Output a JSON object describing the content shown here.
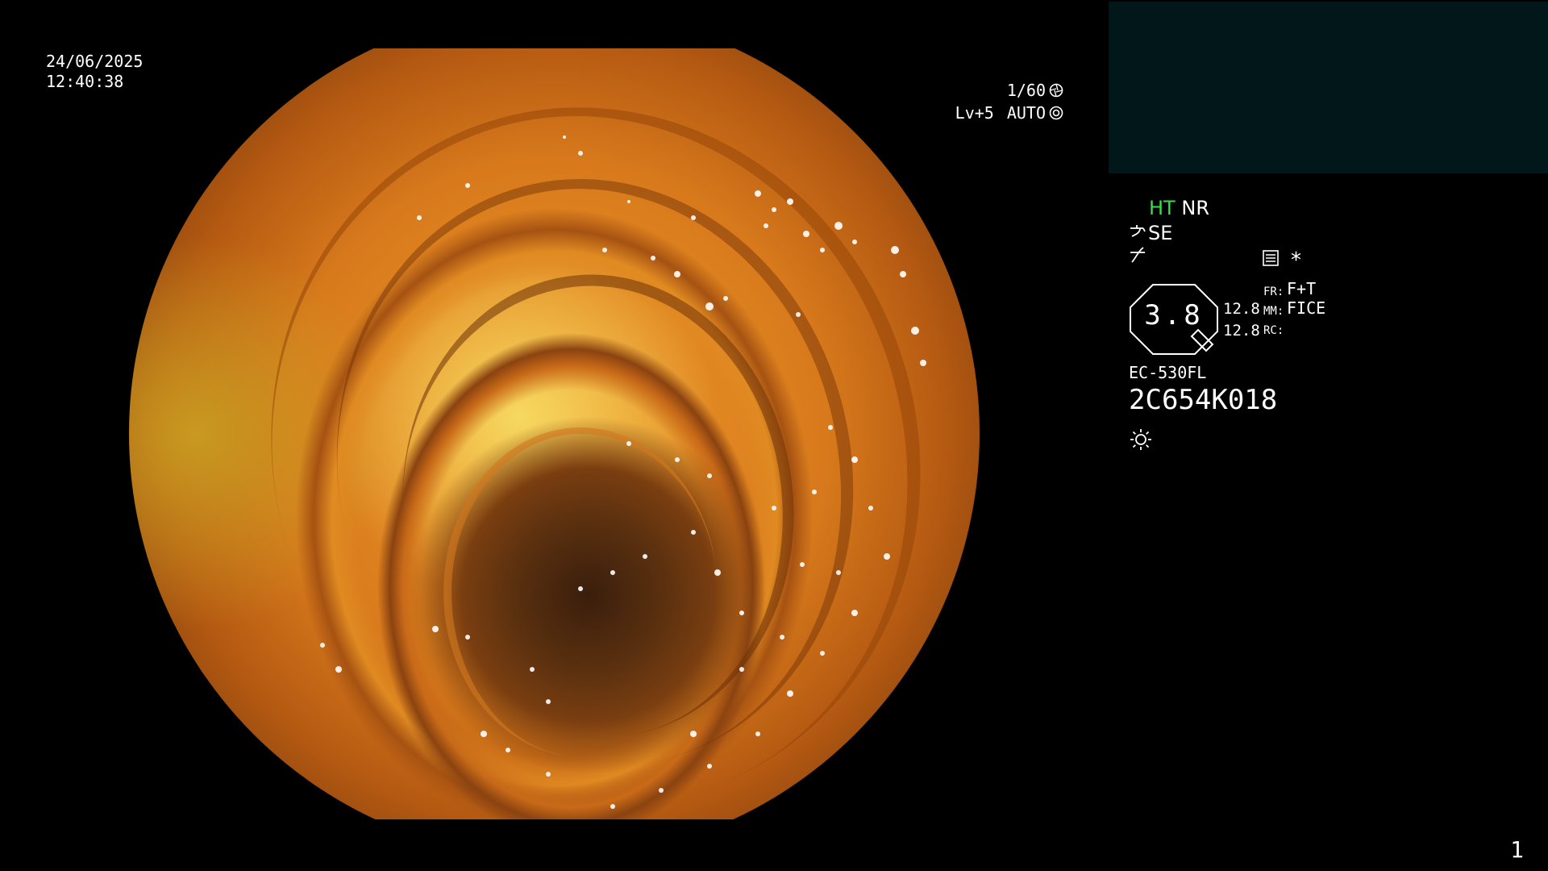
{
  "overlay": {
    "date": "24/06/2025",
    "time": "12:40:38",
    "shutter": "1/60",
    "shutter_icon": "shutter-icon",
    "level": "Lv+5",
    "exposure_mode": "AUTO",
    "exposure_icon": "iris-icon"
  },
  "info_panel": {
    "ht_label": "HT",
    "nr_label": "NR",
    "se_label": "SE",
    "se_icon": "scope-icon",
    "power_icon": "power-curve-icon",
    "menu_icon": "menu-list-icon",
    "asterisk": "*",
    "gauge_value": "3.8",
    "gauge_num_1": "12.8",
    "gauge_num_2": "12.8",
    "fr_label": "FR:",
    "mm_label": "MM:",
    "rc_label": "RC:",
    "fr_value": "F+T",
    "mm_value": "FICE",
    "rc_value": "",
    "scope_model": "EC-530FL",
    "serial_number": "2C654K018",
    "light_icon": "light-sun-icon"
  },
  "page_number": "1",
  "colors": {
    "background": "#000000",
    "dark_panel": "#02171a",
    "ht_green": "#37e04a",
    "text": "#ffffff"
  }
}
